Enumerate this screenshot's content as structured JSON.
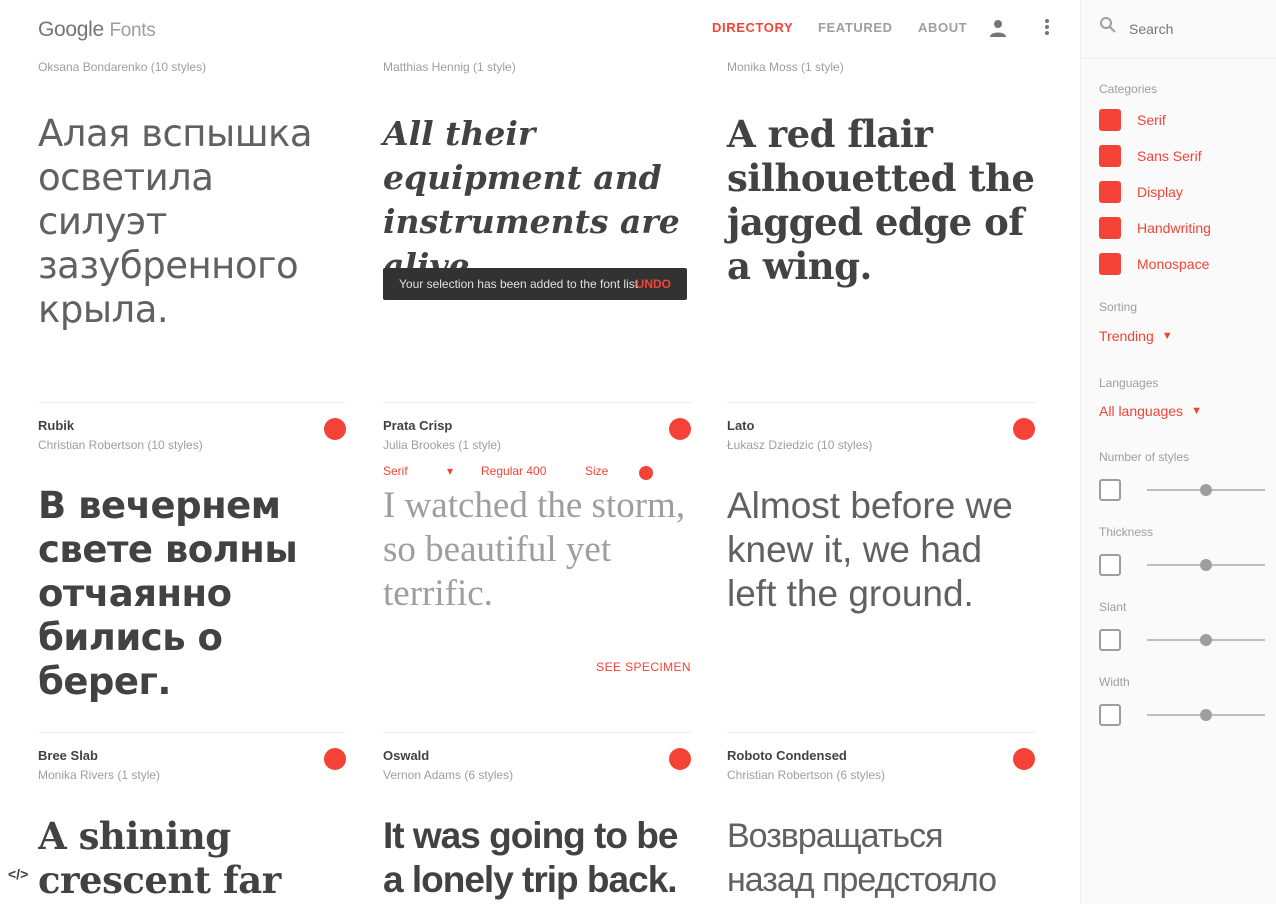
{
  "header": {
    "logo_brand": "Google",
    "logo_product": "Fonts",
    "nav": [
      "DIRECTORY",
      "FEATURED",
      "ABOUT"
    ]
  },
  "top_row": [
    {
      "subtitle": "Oksana Bondarenko (10 styles)",
      "sample": "Алая вспышка осветила силуэт зазубренного крыла."
    },
    {
      "subtitle": "Matthias Hennig (1 style)",
      "sample": "All their equipment and instruments are alive."
    },
    {
      "subtitle": "Monika Moss (1 style)",
      "sample": "A red flair silhouetted the jagged edge of a wing."
    }
  ],
  "toast": {
    "message": "Your selection has been added to the font list",
    "action": "UNDO"
  },
  "mid_row": [
    {
      "name": "Rubik",
      "designer": "Christian Robertson (10 styles)",
      "sample": "В вечернем свете волны отчаянно бились о берег."
    },
    {
      "name": "Prata Crisp",
      "designer": "Julia Brookes (1 style)",
      "sample": "I watched the storm, so beautiful yet terrific.",
      "toolbar": {
        "style": "Serif",
        "weight": "Regular 400",
        "size": "Size"
      },
      "see_spec": "SEE SPECIMEN"
    },
    {
      "name": "Lato",
      "designer": "Łukasz Dziedzic (10 styles)",
      "sample": "Almost before we knew it, we had left the ground."
    }
  ],
  "bottom_row": [
    {
      "name": "Bree Slab",
      "designer": "Monika Rivers (1 style)",
      "sample": "A shining crescent far"
    },
    {
      "name": "Oswald",
      "designer": "Vernon Adams (6 styles)",
      "sample": "It was going to be a lonely trip back."
    },
    {
      "name": "Roboto Condensed",
      "designer": "Christian Robertson (6 styles)",
      "sample": "Возвращаться назад предстояло"
    }
  ],
  "sidebar": {
    "search_placeholder": "Search",
    "categories_label": "Categories",
    "categories": [
      "Serif",
      "Sans Serif",
      "Display",
      "Handwriting",
      "Monospace"
    ],
    "sorting_label": "Sorting",
    "sorting_value": "Trending",
    "languages_label": "Languages",
    "languages_value": "All languages",
    "sliders": [
      {
        "label": "Number of styles",
        "value": 0.5
      },
      {
        "label": "Thickness",
        "value": 0.5
      },
      {
        "label": "Slant",
        "value": 0.5
      },
      {
        "label": "Width",
        "value": 0.5
      }
    ]
  },
  "colors": {
    "accent": "#f44336",
    "text": "#424242",
    "muted": "#9e9e9e",
    "toast_bg": "#323232"
  }
}
